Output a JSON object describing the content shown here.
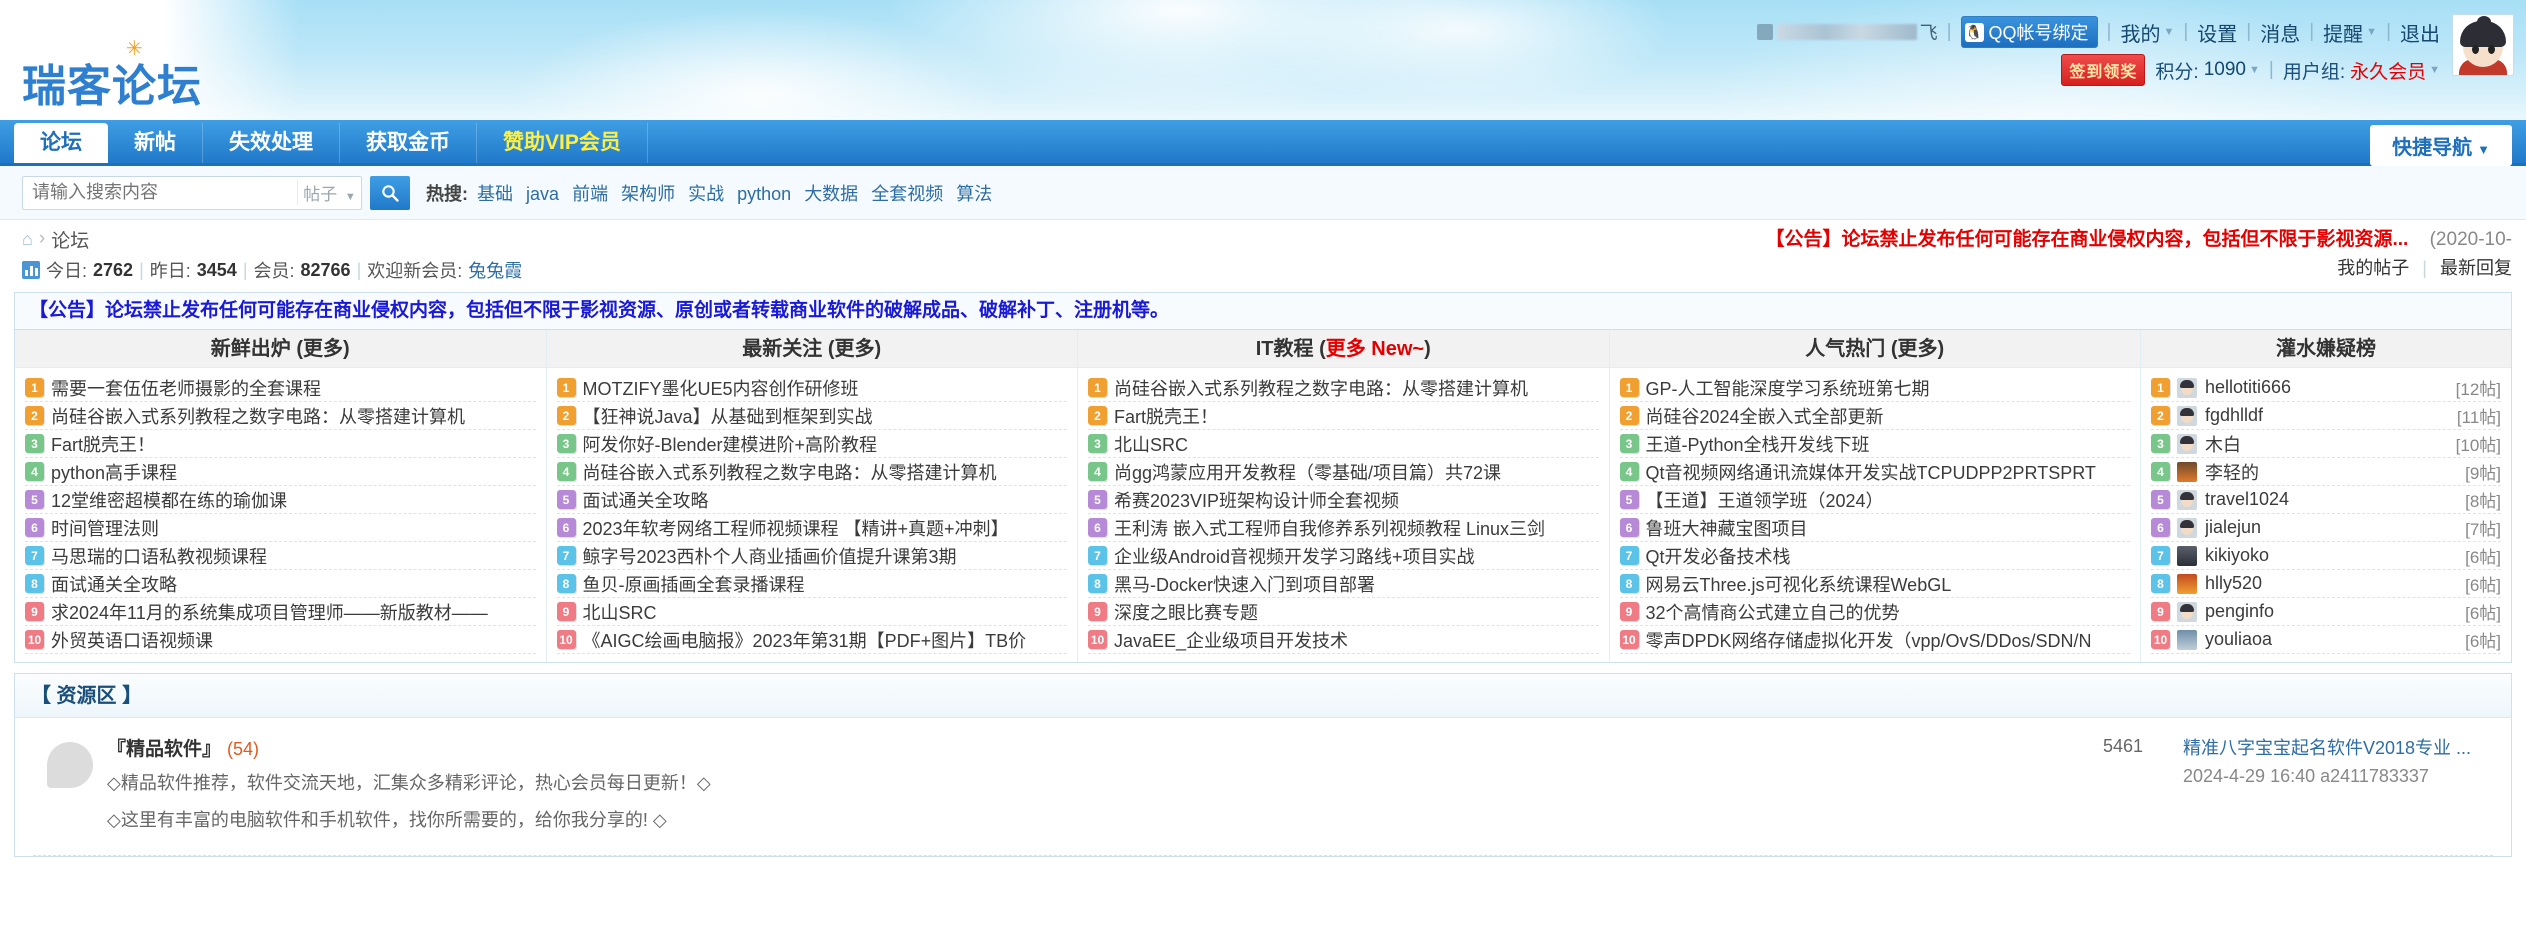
{
  "site": {
    "logo_text": "瑞客论坛"
  },
  "userbar": {
    "username_tail": "飞",
    "qq_bind": "QQ帐号绑定",
    "links": [
      "我的",
      "设置",
      "消息",
      "提醒",
      "退出"
    ],
    "sign_button": "签到领奖",
    "points_label": "积分:",
    "points_value": "1090",
    "usergroup_label": "用户组:",
    "usergroup_value": "永久会员"
  },
  "nav": {
    "items": [
      {
        "label": "论坛",
        "active": true
      },
      {
        "label": "新帖",
        "active": false
      },
      {
        "label": "失效处理",
        "active": false
      },
      {
        "label": "获取金币",
        "active": false
      },
      {
        "label": "赞助VIP会员",
        "active": false,
        "vip": true
      }
    ],
    "quick_nav": "快捷导航"
  },
  "search": {
    "placeholder": "请输入搜索内容",
    "type": "帖子",
    "hot_label": "热搜:",
    "hot_keywords": [
      "基础",
      "java",
      "前端",
      "架构师",
      "实战",
      "python",
      "大数据",
      "全套视频",
      "算法"
    ]
  },
  "breadcrumb": {
    "home": "home-icon",
    "current": "论坛"
  },
  "stats": {
    "today_label": "今日:",
    "today_value": "2762",
    "yesterday_label": "昨日:",
    "yesterday_value": "3454",
    "members_label": "会员:",
    "members_value": "82766",
    "welcome_label": "欢迎新会员:",
    "welcome_value": "兔兔霞"
  },
  "announce_top": {
    "text": "【公告】论坛禁止发布任何可能存在商业侵权内容，包括但不限于影视资源...",
    "date": "(2020-10-"
  },
  "mylinks": {
    "posts": "我的帖子",
    "replies": "最新回复"
  },
  "notice": "【公告】论坛禁止发布任何可能存在商业侵权内容，包括但不限于影视资源、原创或者转载商业软件的破解成品、破解补丁、注册机等。",
  "portal": {
    "columns": [
      {
        "title": "新鲜出炉 (更多)",
        "title_plain": "新鲜出炉 (更多)",
        "type": "posts",
        "items": [
          "需要一套伍伍老师摄影的全套课程",
          "尚硅谷嵌入式系列教程之数字电路：从零搭建计算机",
          "Fart脱壳王！",
          "python高手课程",
          "12堂维密超模都在练的瑜伽课",
          "时间管理法则",
          "马思瑞的口语私教视频课程",
          "面试通关全攻略",
          "求2024年11月的系统集成项目管理师——新版教材——",
          "外贸英语口语视频课"
        ]
      },
      {
        "title": "最新关注 (更多)",
        "title_plain": "最新关注 (更多)",
        "type": "posts",
        "items": [
          "MOTZIFY墨化UE5内容创作研修班",
          "【狂神说Java】从基础到框架到实战",
          "阿发你好-Blender建模进阶+高阶教程",
          "尚硅谷嵌入式系列教程之数字电路：从零搭建计算机",
          "面试通关全攻略",
          "2023年软考网络工程师视频课程 【精讲+真题+冲刺】",
          "鲸字号2023西朴个人商业插画价值提升课第3期",
          "鱼贝-原画插画全套录播课程",
          "北山SRC",
          "《AIGC绘画电脑报》2023年第31期【PDF+图片】TB价"
        ]
      },
      {
        "title": "IT教程 (更多 New~)",
        "title_main": "IT教程 (",
        "title_red": "更多 New~",
        "title_tail": ")",
        "type": "posts",
        "items": [
          "尚硅谷嵌入式系列教程之数字电路：从零搭建计算机",
          "Fart脱壳王！",
          "北山SRC",
          "尚gg鸿蒙应用开发教程（零基础/项目篇）共72课",
          "希赛2023VIP班架构设计师全套视频",
          "王利涛 嵌入式工程师自我修养系列视频教程 Linux三剑",
          "企业级Android音视频开发学习路线+项目实战",
          "黑马-Docker快速入门到项目部署",
          "深度之眼比赛专题",
          "JavaEE_企业级项目开发技术"
        ]
      },
      {
        "title": "人气热门 (更多)",
        "title_plain": "人气热门 (更多)",
        "type": "posts",
        "items": [
          "GP-人工智能深度学习系统班第七期",
          "尚硅谷2024全嵌入式全部更新",
          "王道-Python全栈开发线下班",
          "Qt音视频网络通讯流媒体开发实战TCPUDPP2PRTSPRT",
          "【王道】王道领学班（2024）",
          "鲁班大神藏宝图项目",
          "Qt开发必备技术栈",
          "网易云Three.js可视化系统课程WebGL",
          "32个高情商公式建立自己的优势",
          "零声DPDK网络存储虚拟化开发（vpp/OvS/DDos/SDN/N"
        ]
      },
      {
        "title": "灌水嫌疑榜",
        "title_plain": "灌水嫌疑榜",
        "type": "users",
        "items": [
          {
            "name": "hellotiti666",
            "count": "[12帖]",
            "avatar": "default"
          },
          {
            "name": "fgdhlldf",
            "count": "[11帖]",
            "avatar": "default"
          },
          {
            "name": "木白",
            "count": "[10帖]",
            "avatar": "default"
          },
          {
            "name": "李轻的",
            "count": "[9帖]",
            "avatar": "alt1"
          },
          {
            "name": "travel1024",
            "count": "[8帖]",
            "avatar": "default"
          },
          {
            "name": "jialejun",
            "count": "[7帖]",
            "avatar": "default"
          },
          {
            "name": "kikiyoko",
            "count": "[6帖]",
            "avatar": "alt2"
          },
          {
            "name": "hlly520",
            "count": "[6帖]",
            "avatar": "alt3"
          },
          {
            "name": "penginfo",
            "count": "[6帖]",
            "avatar": "default"
          },
          {
            "name": "youliaoa",
            "count": "[6帖]",
            "avatar": "alt4"
          }
        ]
      }
    ]
  },
  "resource": {
    "section_title": "【 资源区 】",
    "forum_name": "『精品软件』",
    "forum_count": "(54)",
    "desc_line1": "◇精品软件推荐，软件交流天地，汇集众多精彩评论，热心会员每日更新！◇",
    "desc_line2": "◇这里有丰富的电脑软件和手机软件，找你所需要的，给你我分享的! ◇",
    "post_count": "5461",
    "last_post_title": "精准八字宝宝起名软件V2018专业 ...",
    "last_post_time": "2024-4-29 16:40 a2411783337"
  }
}
